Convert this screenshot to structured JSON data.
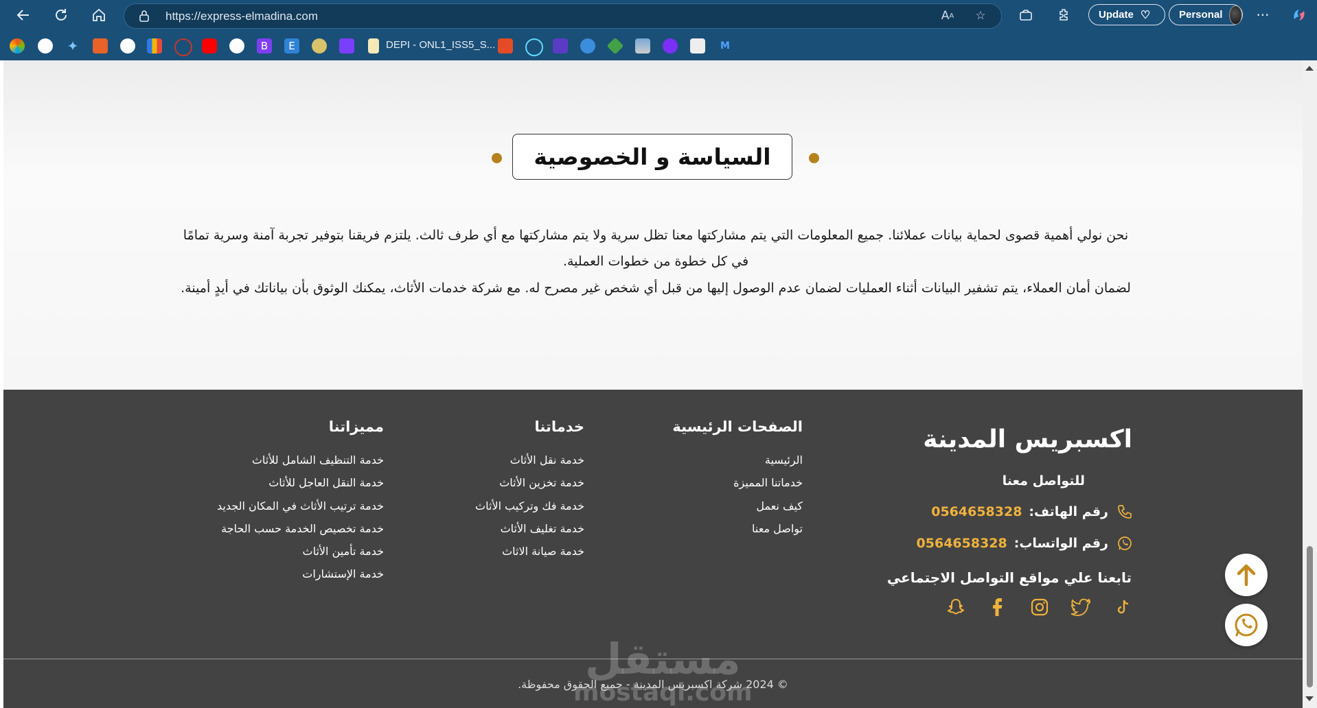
{
  "browser": {
    "url": "https://express-elmadina.com",
    "update_label": "Update",
    "profile_label": "Personal",
    "bookmark_label": "DEPI - ONL1_ISS5_S..."
  },
  "privacy": {
    "title": "السياسة و الخصوصية",
    "paragraph1": "نحن نولي أهمية قصوى لحماية بيانات عملائنا. جميع المعلومات التي يتم مشاركتها معنا تظل سرية ولا يتم مشاركتها مع أي طرف ثالث. يلتزم فريقنا بتوفير تجربة آمنة وسرية تمامًا في كل خطوة من خطوات العملية.",
    "paragraph2": "لضمان أمان العملاء، يتم تشفير البيانات أثناء العمليات لضمان عدم الوصول إليها من قبل أي شخص غير مصرح له. مع شركة خدمات الأثاث، يمكنك الوثوق بأن بياناتك في أيدٍ أمينة."
  },
  "footer": {
    "brand": "اكسبريس المدينة",
    "contact_heading": "للتواصل معنا",
    "phone_label": "رقم الهاتف:",
    "phone_number": "0564658328",
    "whatsapp_label": "رقم الواتساب:",
    "whatsapp_number": "0564658328",
    "follow_heading": "تابعنا علي مواقع التواصل الاجتماعي",
    "social_icons": [
      "tiktok-icon",
      "twitter-icon",
      "instagram-icon",
      "facebook-icon",
      "snapchat-icon"
    ],
    "columns": {
      "main_pages": {
        "title": "الصفحات الرئيسية",
        "items": [
          "الرئيسية",
          "خدماتنا المميزة",
          "كيف نعمل",
          "تواصل معنا"
        ]
      },
      "services": {
        "title": "خدماتنا",
        "items": [
          "خدمة نقل الأثاث",
          "خدمة تخزين الأثاث",
          "خدمة فك وتركيب الأثاث",
          "خدمة تغليف الأثاث",
          "خدمة صيانة الاثاث"
        ]
      },
      "features": {
        "title": "مميزاتنا",
        "items": [
          "خدمة التنظيف الشامل للأثاث",
          "خدمة النقل العاجل للأثاث",
          "خدمة ترتيب الأثاث في المكان الجديد",
          "خدمة تخصيص الخدمة حسب الحاجة",
          "خدمة تأمين الأثاث",
          "خدمة الإستشارات"
        ]
      }
    },
    "copyright": "© 2024 شركة اكسبريس المدينة - جميع الحقوق محفوظة."
  },
  "watermark": {
    "arabic": "مستقل",
    "latin": "mostaql.com"
  },
  "colors": {
    "accent": "#b5821f",
    "phone": "#f0b23c",
    "footer_bg": "#434343",
    "chrome": "#1a4f78"
  }
}
